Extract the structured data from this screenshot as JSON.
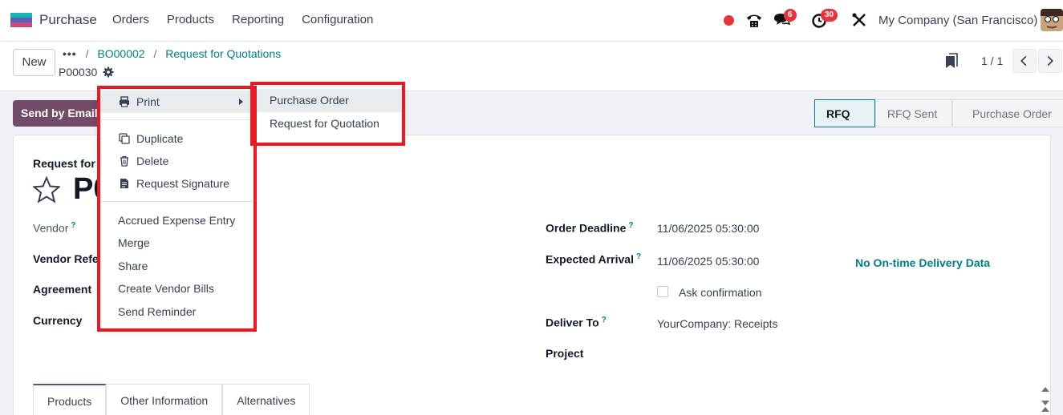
{
  "navbar": {
    "app_name": "Purchase",
    "menu": [
      "Orders",
      "Products",
      "Reporting",
      "Configuration"
    ],
    "messages_badge": "6",
    "activities_badge": "30",
    "company": "My Company (San Francisco)"
  },
  "control_panel": {
    "new_label": "New",
    "breadcrumb_dots": "•••",
    "breadcrumb": [
      "BO00002",
      "Request for Quotations"
    ],
    "record_name": "P00030",
    "pager": "1 / 1"
  },
  "actions": {
    "send_email": "Send by Email"
  },
  "statusbar": [
    "RFQ",
    "RFQ Sent",
    "Purchase Order"
  ],
  "form": {
    "title_label": "Request for",
    "title_partial": "P0",
    "left_fields": [
      "Vendor",
      "Vendor Refe",
      "Agreement",
      "Currency"
    ],
    "order_deadline_label": "Order Deadline",
    "order_deadline_value": "11/06/2025 05:30:00",
    "expected_arrival_label": "Expected Arrival",
    "expected_arrival_value": "11/06/2025 05:30:00",
    "ontime": "No On-time Delivery Data",
    "ask_confirmation": "Ask confirmation",
    "deliver_to_label": "Deliver To",
    "deliver_to_value": "YourCompany: Receipts",
    "project_label": "Project",
    "help_mark": "?"
  },
  "tabs": [
    "Products",
    "Other Information",
    "Alternatives"
  ],
  "gear_menu": {
    "print": "Print",
    "group1": [
      "Duplicate",
      "Delete",
      "Request Signature"
    ],
    "group2": [
      "Accrued Expense Entry",
      "Merge",
      "Share",
      "Create Vendor Bills",
      "Send Reminder"
    ]
  },
  "print_submenu": [
    "Purchase Order",
    "Request for Quotation"
  ],
  "colors": {
    "brand": "#714b67",
    "accent": "#017e84",
    "highlight_box": "#e11d26"
  }
}
